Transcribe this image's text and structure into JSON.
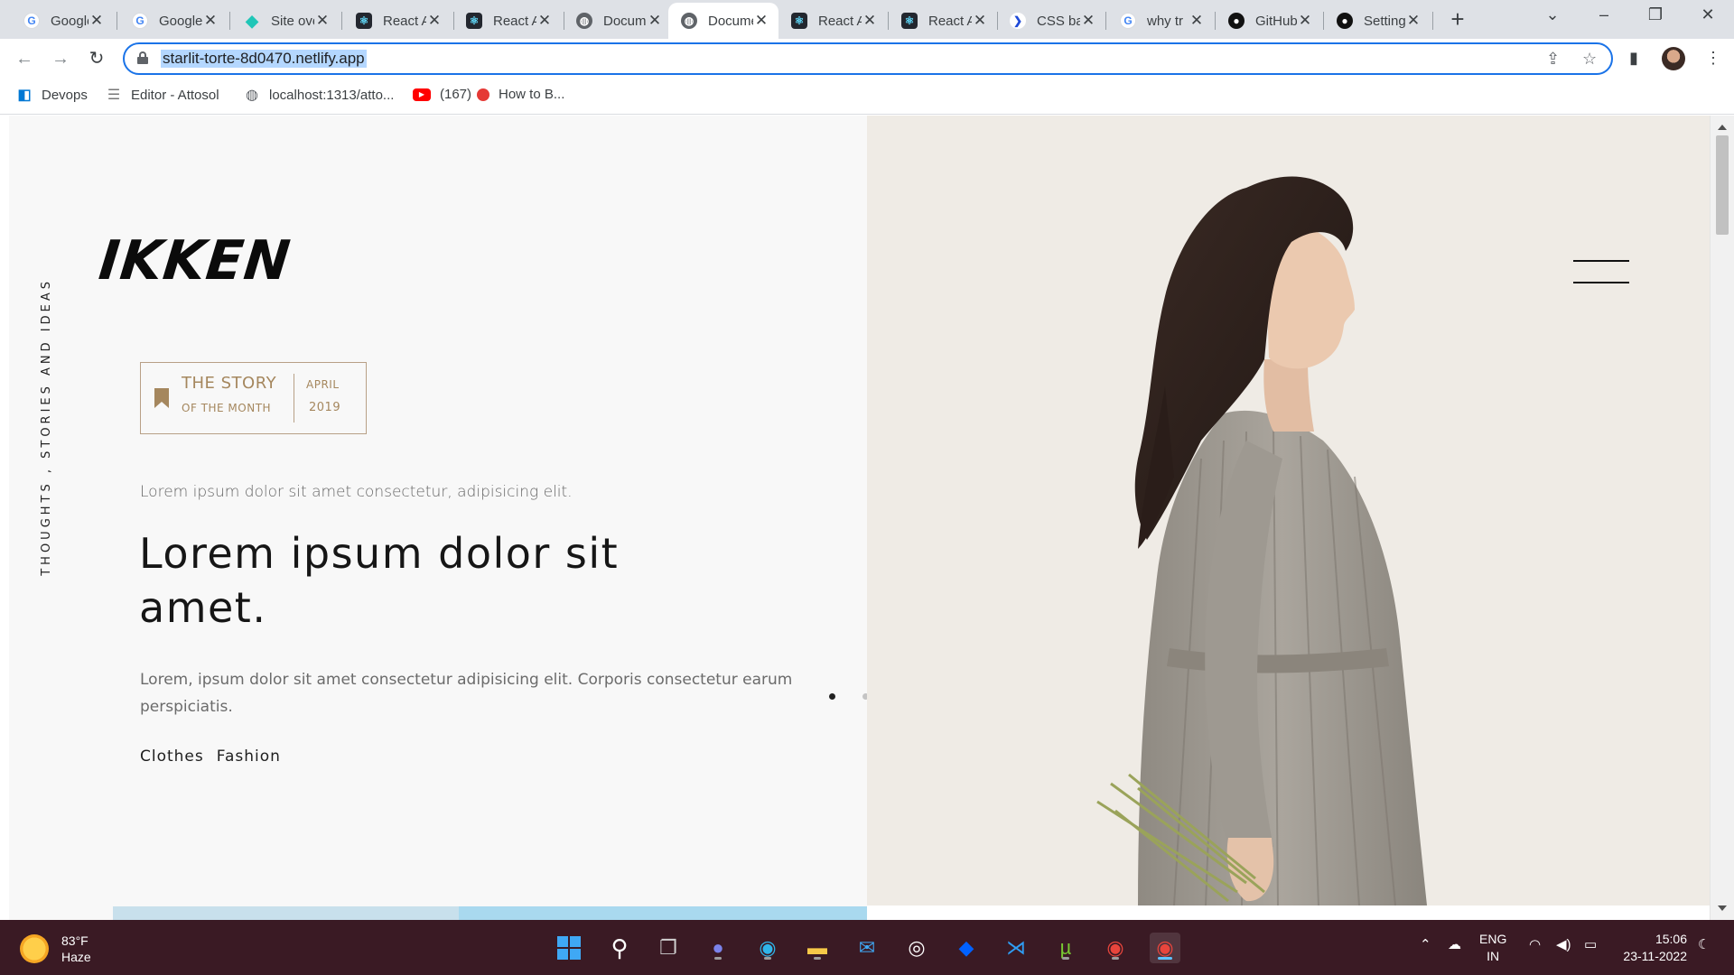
{
  "browser": {
    "tabs": [
      {
        "title": "Google",
        "icon": "google-icon"
      },
      {
        "title": "Google",
        "icon": "google-icon"
      },
      {
        "title": "Site overview",
        "icon": "netlify-icon"
      },
      {
        "title": "React App",
        "icon": "react-icon"
      },
      {
        "title": "React App",
        "icon": "react-icon"
      },
      {
        "title": "Document",
        "icon": "globe-icon"
      },
      {
        "title": "Document",
        "icon": "globe-icon",
        "active": true
      },
      {
        "title": "React App",
        "icon": "react-icon"
      },
      {
        "title": "React App",
        "icon": "react-icon"
      },
      {
        "title": "CSS basics",
        "icon": "powershell-icon"
      },
      {
        "title": "why tr",
        "icon": "google-icon"
      },
      {
        "title": "GitHub",
        "icon": "github-icon"
      },
      {
        "title": "Settings",
        "icon": "github-icon"
      }
    ],
    "url": "starlit-torte-8d0470.netlify.app",
    "bookmarks": [
      {
        "label": "Devops",
        "icon": "azure-devops-icon"
      },
      {
        "label": "Editor - Attosol",
        "icon": "editor-icon"
      },
      {
        "label": "localhost:1313/atto...",
        "icon": "globe-icon"
      },
      {
        "label": "(167)",
        "icon": "youtube-icon"
      },
      {
        "label": "How to B...",
        "icon": "red-dot-icon"
      }
    ]
  },
  "page": {
    "vertical_text": "THOUGHTS , STORIES AND IDEAS",
    "logo": "IKKEN",
    "story_box": {
      "title": "THE STORY",
      "subtitle": "OF THE MONTH",
      "month": "APRIL",
      "year": "2019"
    },
    "intro": "Lorem ipsum dolor sit amet consectetur, adipisicing elit.",
    "headline": "Lorem ipsum dolor sit amet.",
    "body": "Lorem, ipsum dolor sit amet consectetur adipisicing elit. Corporis consectetur earum perspiciatis.",
    "tags": [
      "Clothes",
      "Fashion"
    ],
    "slider_dots": {
      "count": 3,
      "active_index": 0
    },
    "colors": {
      "accent": "#a5875e",
      "left_background": "#f8f8f8",
      "right_background": "#efebe5",
      "bottom_strip_left": "#c8e0ec",
      "bottom_strip_right": "#a9d9ef"
    }
  },
  "taskbar": {
    "weather_temp": "83°F",
    "weather_desc": "Haze",
    "language": "ENG",
    "region": "IN",
    "time": "15:06",
    "date": "23-11-2022",
    "apps": [
      "start-icon",
      "search-icon",
      "task-view-icon",
      "teams-chat-icon",
      "edge-icon",
      "file-explorer-icon",
      "mail-icon",
      "app-icon",
      "dropbox-icon",
      "vscode-icon",
      "utorrent-icon",
      "chrome-profile-icon",
      "chrome-icon"
    ]
  }
}
